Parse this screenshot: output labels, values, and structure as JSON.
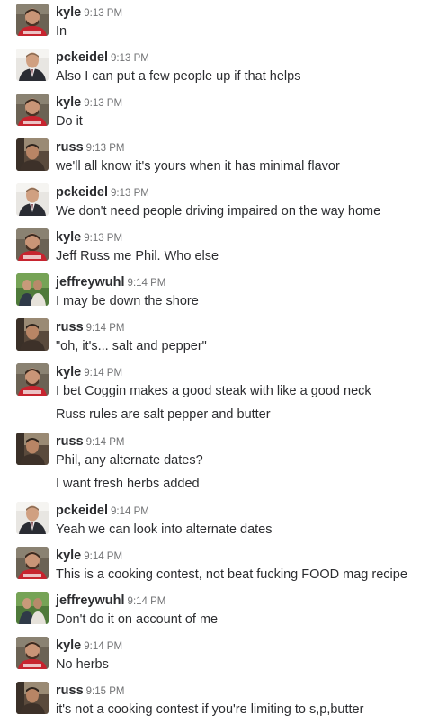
{
  "messages": [
    {
      "user": "kyle",
      "time": "9:13 PM",
      "avatar": "kyle-avatar",
      "lines": [
        "In"
      ]
    },
    {
      "user": "pckeidel",
      "time": "9:13 PM",
      "avatar": "pckeidel-avatar",
      "lines": [
        "Also I can put a few people up if that helps"
      ]
    },
    {
      "user": "kyle",
      "time": "9:13 PM",
      "avatar": "kyle-avatar",
      "lines": [
        "Do it"
      ]
    },
    {
      "user": "russ",
      "time": "9:13 PM",
      "avatar": "russ-avatar",
      "lines": [
        "we'll all know it's yours when it has minimal flavor"
      ]
    },
    {
      "user": "pckeidel",
      "time": "9:13 PM",
      "avatar": "pckeidel-avatar",
      "lines": [
        "We don't need people driving impaired on the way home"
      ]
    },
    {
      "user": "kyle",
      "time": "9:13 PM",
      "avatar": "kyle-avatar",
      "lines": [
        "Jeff Russ me Phil. Who else"
      ]
    },
    {
      "user": "jeffreywuhl",
      "time": "9:14 PM",
      "avatar": "jeffreywuhl-avatar",
      "lines": [
        "I may be down the shore"
      ]
    },
    {
      "user": "russ",
      "time": "9:14 PM",
      "avatar": "russ-avatar",
      "lines": [
        "\"oh, it's... salt and pepper\""
      ]
    },
    {
      "user": "kyle",
      "time": "9:14 PM",
      "avatar": "kyle-avatar",
      "lines": [
        "I bet Coggin makes a good steak with like a good neck",
        "Russ rules are salt pepper and butter"
      ]
    },
    {
      "user": "russ",
      "time": "9:14 PM",
      "avatar": "russ-avatar",
      "lines": [
        "Phil, any alternate dates?",
        "I want fresh herbs added"
      ]
    },
    {
      "user": "pckeidel",
      "time": "9:14 PM",
      "avatar": "pckeidel-avatar",
      "lines": [
        "Yeah we can look into alternate dates"
      ]
    },
    {
      "user": "kyle",
      "time": "9:14 PM",
      "avatar": "kyle-avatar",
      "lines": [
        "This is a cooking contest, not beat fucking FOOD mag recipe"
      ]
    },
    {
      "user": "jeffreywuhl",
      "time": "9:14 PM",
      "avatar": "jeffreywuhl-avatar",
      "lines": [
        "Don't do it on account of me"
      ]
    },
    {
      "user": "kyle",
      "time": "9:14 PM",
      "avatar": "kyle-avatar",
      "lines": [
        "No herbs"
      ]
    },
    {
      "user": "russ",
      "time": "9:15 PM",
      "avatar": "russ-avatar",
      "lines": [
        "it's not a cooking contest if you're limiting to s,p,butter"
      ]
    }
  ],
  "colors": {
    "text": "#2c2d30",
    "timestamp": "#717274",
    "background": "#ffffff"
  }
}
